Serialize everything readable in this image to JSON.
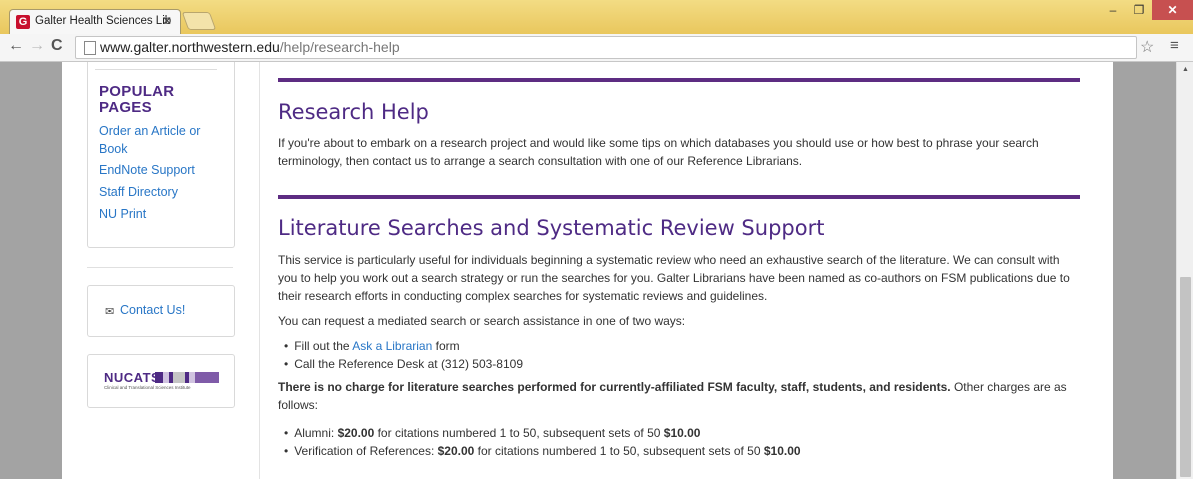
{
  "browser": {
    "tab_title": "Galter Health Sciences Lib",
    "tab_favicon": "G",
    "url_domain": "www.galter.northwestern.edu",
    "url_path": "/help/research-help"
  },
  "sidebar": {
    "popular_heading_1": "POPULAR",
    "popular_heading_2": "PAGES",
    "links": [
      "Order an Article or Book",
      "EndNote Support",
      "Staff Directory",
      "NU Print"
    ],
    "contact_label": "Contact Us!",
    "logo_text": "NUCATS",
    "logo_subtitle": "Clinical and Translational Sciences Institute"
  },
  "main": {
    "research_help_title": "Research Help",
    "research_help_text": "If you're about to embark on a research project and would like some tips on which databases you should use or how best to phrase your search terminology, then contact us to arrange a search consultation with one of our Reference Librarians.",
    "lit_title": "Literature Searches and Systematic Review Support",
    "lit_text": "This service is particularly useful for individuals beginning a systematic review who need an exhaustive search of the literature. We can consult with you to help you work out a search strategy or run the searches for you. Galter Librarians have been named as co-authors on FSM publications due to their research efforts in conducting complex searches for systematic reviews and guidelines.",
    "request_text": "You can request a mediated search or search assistance in one of two ways:",
    "way1_prefix": "Fill out the ",
    "way1_link": "Ask a Librarian",
    "way1_suffix": " form",
    "way2": "Call the Reference Desk at (312) 503-8109",
    "charge_bold": "There is no charge for literature searches performed for currently-affiliated FSM faculty, staff, students, and residents.",
    "charge_rest": " Other charges are as follows:",
    "alumni_prefix": "Alumni: ",
    "alumni_price": "$20.00",
    "alumni_mid": " for citations numbered 1 to 50, subsequent sets of 50 ",
    "alumni_price2": "$10.00",
    "verif_prefix": "Verification of References: ",
    "verif_price": "$20.00",
    "verif_mid": " for citations numbered 1 to 50, subsequent sets of 50 ",
    "verif_price2": "$10.00"
  }
}
